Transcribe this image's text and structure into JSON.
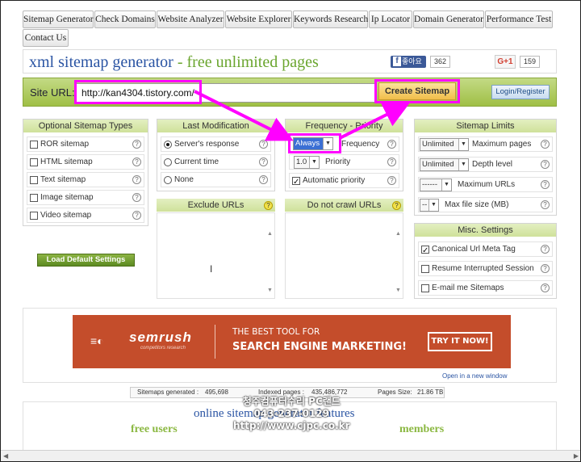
{
  "nav": {
    "tabs": [
      "Sitemap Generator",
      "Check Domains",
      "Website Analyzer",
      "Website Explorer",
      "Keywords Research",
      "Ip Locator",
      "Domain Generator",
      "Performance Test",
      "Contact Us"
    ]
  },
  "header": {
    "title_part1": "xml sitemap generator",
    "title_dash": " - ",
    "title_part2": "free unlimited pages",
    "fb_like": "좋아요",
    "fb_count": "362",
    "gplus_label": "G+1",
    "gplus_count": "159"
  },
  "urlbar": {
    "label": "Site URL:",
    "value": "http://kan4304.tistory.com/",
    "create_button": "Create Sitemap",
    "login_button": "Login/Register"
  },
  "optional_types": {
    "title": "Optional Sitemap Types",
    "items": [
      "ROR sitemap",
      "HTML sitemap",
      "Text sitemap",
      "Image sitemap",
      "Video sitemap"
    ]
  },
  "last_modification": {
    "title": "Last Modification",
    "options": [
      "Server's response",
      "Current time",
      "None"
    ]
  },
  "frequency": {
    "title": "Frequency - Priority",
    "freq_value": "Always",
    "freq_label": "Frequency",
    "priority_value": "1.0",
    "priority_label": "Priority",
    "auto_label": "Automatic priority"
  },
  "limits": {
    "title": "Sitemap Limits",
    "rows": [
      {
        "value": "Unlimited",
        "label": "Maximum pages"
      },
      {
        "value": "Unlimited",
        "label": "Depth level"
      },
      {
        "value": "------",
        "label": "Maximum URLs"
      },
      {
        "value": "--",
        "label": "Max file size (MB)"
      }
    ]
  },
  "misc": {
    "title": "Misc. Settings",
    "items": [
      "Canonical Url Meta Tag",
      "Resume Interrupted Session",
      "E-mail me Sitemaps"
    ]
  },
  "exclude": {
    "title": "Exclude URLs"
  },
  "no_crawl": {
    "title": "Do not crawl URLs"
  },
  "load_default": "Load Default Settings",
  "ad": {
    "logo": "semrush",
    "logo_sub": "competitors research",
    "line1": "THE BEST TOOL FOR",
    "line2": "SEARCH ENGINE MARKETING!",
    "button": "TRY IT NOW!",
    "link": "Open in a new window",
    "brand_color": "#c44d2b"
  },
  "stats": {
    "generated_label": "Sitemaps generated :",
    "generated_value": "495,698",
    "indexed_label": "Indexed pages :",
    "indexed_value": "435,486,772",
    "size_label": "Pages Size:",
    "size_value": "21.86 TB"
  },
  "bottom": {
    "title": "online sitemap generator features",
    "col1": "free users",
    "col2": "members"
  },
  "watermark": {
    "line1": "청주컴퓨터수리 PC랜드",
    "line2": "043-237-0129",
    "line3": "http://www.cjpc.co.kr"
  },
  "colors": {
    "highlight": "#ff00ff",
    "accent_green": "#8bb842",
    "title_blue": "#2a54a3"
  }
}
